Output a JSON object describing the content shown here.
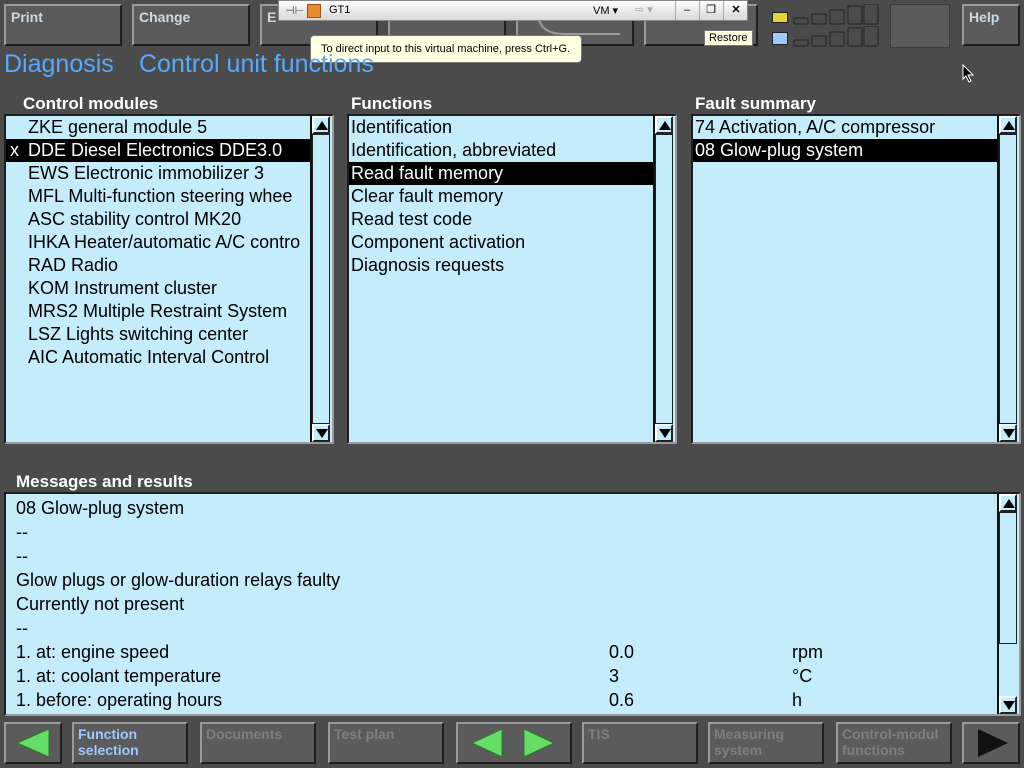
{
  "toolbar": {
    "print": "Print",
    "change": "Change",
    "end_partial": "E",
    "help": "Help"
  },
  "vm_bar": {
    "name": "GT1",
    "menu": "VM",
    "tooltip": "To direct input to this virtual machine, press Ctrl+G.",
    "restore": "Restore"
  },
  "title": {
    "main": "Diagnosis",
    "sub": "Control unit functions"
  },
  "control_modules": {
    "heading": "Control modules",
    "items": [
      {
        "mark": "",
        "label": "ZKE general module 5"
      },
      {
        "mark": "x",
        "label": "DDE Diesel Electronics DDE3.0"
      },
      {
        "mark": "",
        "label": "EWS Electronic immobilizer 3"
      },
      {
        "mark": "",
        "label": "MFL Multi-function steering whee"
      },
      {
        "mark": "",
        "label": "ASC stability control MK20"
      },
      {
        "mark": "",
        "label": "IHKA Heater/automatic A/C contro"
      },
      {
        "mark": "",
        "label": "RAD Radio"
      },
      {
        "mark": "",
        "label": "KOM Instrument cluster"
      },
      {
        "mark": "",
        "label": "MRS2 Multiple Restraint System"
      },
      {
        "mark": "",
        "label": "LSZ Lights switching center"
      },
      {
        "mark": "",
        "label": "AIC Automatic Interval Control"
      }
    ],
    "selected_index": 1
  },
  "functions": {
    "heading": "Functions",
    "items": [
      "Identification",
      "Identification, abbreviated",
      "Read fault memory",
      "Clear fault memory",
      "Read test code",
      "Component activation",
      "Diagnosis requests"
    ],
    "selected_index": 2
  },
  "fault_summary": {
    "heading": "Fault summary",
    "items": [
      "74 Activation, A/C compressor",
      "08 Glow-plug system"
    ],
    "selected_index": 1
  },
  "messages": {
    "heading": "Messages and results",
    "lines": [
      {
        "text": "08 Glow-plug system",
        "value": "",
        "unit": ""
      },
      {
        "text": "--",
        "value": "",
        "unit": ""
      },
      {
        "text": "--",
        "value": "",
        "unit": ""
      },
      {
        "text": "Glow plugs or glow-duration relays faulty",
        "value": "",
        "unit": ""
      },
      {
        "text": "Currently not present",
        "value": "",
        "unit": ""
      },
      {
        "text": "--",
        "value": "",
        "unit": ""
      },
      {
        "text": "1. at: engine speed",
        "value": "0.0",
        "unit": "rpm"
      },
      {
        "text": "1. at: coolant temperature",
        "value": "3",
        "unit": "°C"
      },
      {
        "text": "1. before: operating hours",
        "value": "0.6",
        "unit": "h"
      }
    ]
  },
  "bottom_bar": {
    "function_selection": "Function\nselection",
    "documents": "Documents",
    "test_plan": "Test plan",
    "tis": "TIS",
    "measuring_system": "Measuring\nsystem",
    "control_module_functions": "Control-modul\nfunctions"
  },
  "colors": {
    "background": "#4b4b4b",
    "list_background": "#c4ecfb",
    "title_blue": "#55aaff",
    "arrow_green": "#66dd66"
  }
}
